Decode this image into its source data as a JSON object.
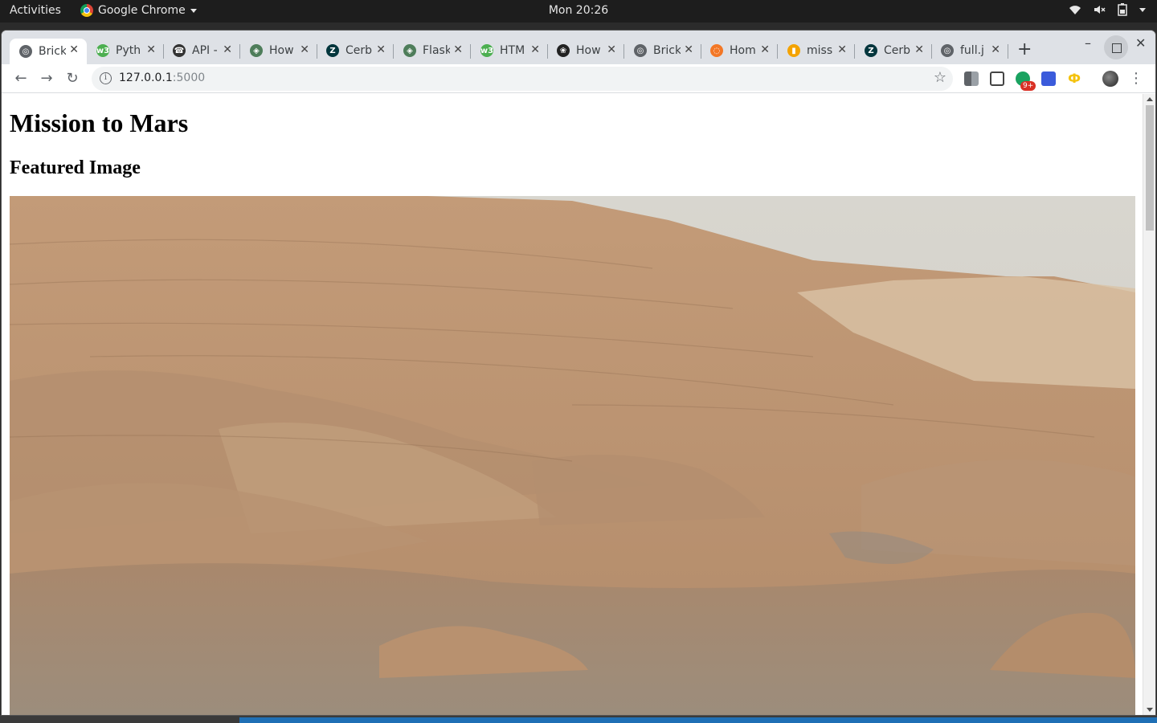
{
  "topbar": {
    "activities": "Activities",
    "app_name": "Google Chrome",
    "clock": "Mon 20:26"
  },
  "browser": {
    "tabs": [
      {
        "title": "Brick",
        "icon": "globe-icon",
        "color": "#5f6368",
        "active": true
      },
      {
        "title": "Pyth",
        "icon": "w3schools-icon",
        "color": "#4caf50"
      },
      {
        "title": "API -",
        "icon": "phone-icon",
        "color": "#333333"
      },
      {
        "title": "How",
        "icon": "diamond-icon",
        "color": "#4e7d5a"
      },
      {
        "title": "Cerb",
        "icon": "zendesk-icon",
        "color": "#03363d"
      },
      {
        "title": "Flask",
        "icon": "diamond-icon",
        "color": "#4e7d5a"
      },
      {
        "title": "HTM",
        "icon": "w3schools-icon",
        "color": "#4caf50"
      },
      {
        "title": "How",
        "icon": "linux-icon",
        "color": "#222222"
      },
      {
        "title": "Brick",
        "icon": "globe-icon",
        "color": "#5f6368"
      },
      {
        "title": "Hom",
        "icon": "jupyter-icon",
        "color": "#f37726"
      },
      {
        "title": "miss",
        "icon": "bookmark-icon",
        "color": "#f4a300"
      },
      {
        "title": "Cerb",
        "icon": "zendesk-icon",
        "color": "#03363d"
      },
      {
        "title": "full.j",
        "icon": "globe-icon",
        "color": "#5f6368"
      }
    ],
    "address": {
      "host": "127.0.0.1",
      "port": ":5000"
    },
    "extension_badge": "9+"
  },
  "page": {
    "heading": "Mission to Mars",
    "subheading": "Featured Image"
  }
}
